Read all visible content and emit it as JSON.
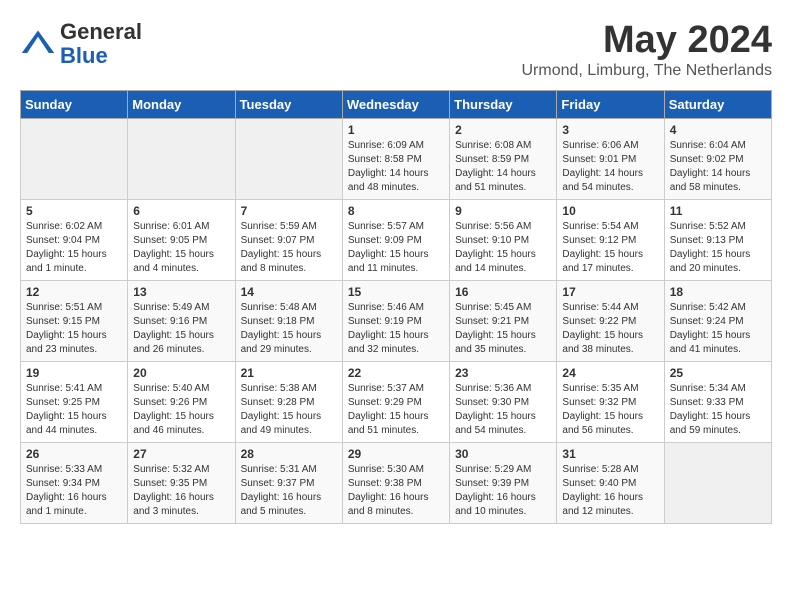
{
  "header": {
    "logo_general": "General",
    "logo_blue": "Blue",
    "month_year": "May 2024",
    "location": "Urmond, Limburg, The Netherlands"
  },
  "days_of_week": [
    "Sunday",
    "Monday",
    "Tuesday",
    "Wednesday",
    "Thursday",
    "Friday",
    "Saturday"
  ],
  "weeks": [
    [
      {
        "day": "",
        "info": ""
      },
      {
        "day": "",
        "info": ""
      },
      {
        "day": "",
        "info": ""
      },
      {
        "day": "1",
        "info": "Sunrise: 6:09 AM\nSunset: 8:58 PM\nDaylight: 14 hours\nand 48 minutes."
      },
      {
        "day": "2",
        "info": "Sunrise: 6:08 AM\nSunset: 8:59 PM\nDaylight: 14 hours\nand 51 minutes."
      },
      {
        "day": "3",
        "info": "Sunrise: 6:06 AM\nSunset: 9:01 PM\nDaylight: 14 hours\nand 54 minutes."
      },
      {
        "day": "4",
        "info": "Sunrise: 6:04 AM\nSunset: 9:02 PM\nDaylight: 14 hours\nand 58 minutes."
      }
    ],
    [
      {
        "day": "5",
        "info": "Sunrise: 6:02 AM\nSunset: 9:04 PM\nDaylight: 15 hours\nand 1 minute."
      },
      {
        "day": "6",
        "info": "Sunrise: 6:01 AM\nSunset: 9:05 PM\nDaylight: 15 hours\nand 4 minutes."
      },
      {
        "day": "7",
        "info": "Sunrise: 5:59 AM\nSunset: 9:07 PM\nDaylight: 15 hours\nand 8 minutes."
      },
      {
        "day": "8",
        "info": "Sunrise: 5:57 AM\nSunset: 9:09 PM\nDaylight: 15 hours\nand 11 minutes."
      },
      {
        "day": "9",
        "info": "Sunrise: 5:56 AM\nSunset: 9:10 PM\nDaylight: 15 hours\nand 14 minutes."
      },
      {
        "day": "10",
        "info": "Sunrise: 5:54 AM\nSunset: 9:12 PM\nDaylight: 15 hours\nand 17 minutes."
      },
      {
        "day": "11",
        "info": "Sunrise: 5:52 AM\nSunset: 9:13 PM\nDaylight: 15 hours\nand 20 minutes."
      }
    ],
    [
      {
        "day": "12",
        "info": "Sunrise: 5:51 AM\nSunset: 9:15 PM\nDaylight: 15 hours\nand 23 minutes."
      },
      {
        "day": "13",
        "info": "Sunrise: 5:49 AM\nSunset: 9:16 PM\nDaylight: 15 hours\nand 26 minutes."
      },
      {
        "day": "14",
        "info": "Sunrise: 5:48 AM\nSunset: 9:18 PM\nDaylight: 15 hours\nand 29 minutes."
      },
      {
        "day": "15",
        "info": "Sunrise: 5:46 AM\nSunset: 9:19 PM\nDaylight: 15 hours\nand 32 minutes."
      },
      {
        "day": "16",
        "info": "Sunrise: 5:45 AM\nSunset: 9:21 PM\nDaylight: 15 hours\nand 35 minutes."
      },
      {
        "day": "17",
        "info": "Sunrise: 5:44 AM\nSunset: 9:22 PM\nDaylight: 15 hours\nand 38 minutes."
      },
      {
        "day": "18",
        "info": "Sunrise: 5:42 AM\nSunset: 9:24 PM\nDaylight: 15 hours\nand 41 minutes."
      }
    ],
    [
      {
        "day": "19",
        "info": "Sunrise: 5:41 AM\nSunset: 9:25 PM\nDaylight: 15 hours\nand 44 minutes."
      },
      {
        "day": "20",
        "info": "Sunrise: 5:40 AM\nSunset: 9:26 PM\nDaylight: 15 hours\nand 46 minutes."
      },
      {
        "day": "21",
        "info": "Sunrise: 5:38 AM\nSunset: 9:28 PM\nDaylight: 15 hours\nand 49 minutes."
      },
      {
        "day": "22",
        "info": "Sunrise: 5:37 AM\nSunset: 9:29 PM\nDaylight: 15 hours\nand 51 minutes."
      },
      {
        "day": "23",
        "info": "Sunrise: 5:36 AM\nSunset: 9:30 PM\nDaylight: 15 hours\nand 54 minutes."
      },
      {
        "day": "24",
        "info": "Sunrise: 5:35 AM\nSunset: 9:32 PM\nDaylight: 15 hours\nand 56 minutes."
      },
      {
        "day": "25",
        "info": "Sunrise: 5:34 AM\nSunset: 9:33 PM\nDaylight: 15 hours\nand 59 minutes."
      }
    ],
    [
      {
        "day": "26",
        "info": "Sunrise: 5:33 AM\nSunset: 9:34 PM\nDaylight: 16 hours\nand 1 minute."
      },
      {
        "day": "27",
        "info": "Sunrise: 5:32 AM\nSunset: 9:35 PM\nDaylight: 16 hours\nand 3 minutes."
      },
      {
        "day": "28",
        "info": "Sunrise: 5:31 AM\nSunset: 9:37 PM\nDaylight: 16 hours\nand 5 minutes."
      },
      {
        "day": "29",
        "info": "Sunrise: 5:30 AM\nSunset: 9:38 PM\nDaylight: 16 hours\nand 8 minutes."
      },
      {
        "day": "30",
        "info": "Sunrise: 5:29 AM\nSunset: 9:39 PM\nDaylight: 16 hours\nand 10 minutes."
      },
      {
        "day": "31",
        "info": "Sunrise: 5:28 AM\nSunset: 9:40 PM\nDaylight: 16 hours\nand 12 minutes."
      },
      {
        "day": "",
        "info": ""
      }
    ]
  ]
}
